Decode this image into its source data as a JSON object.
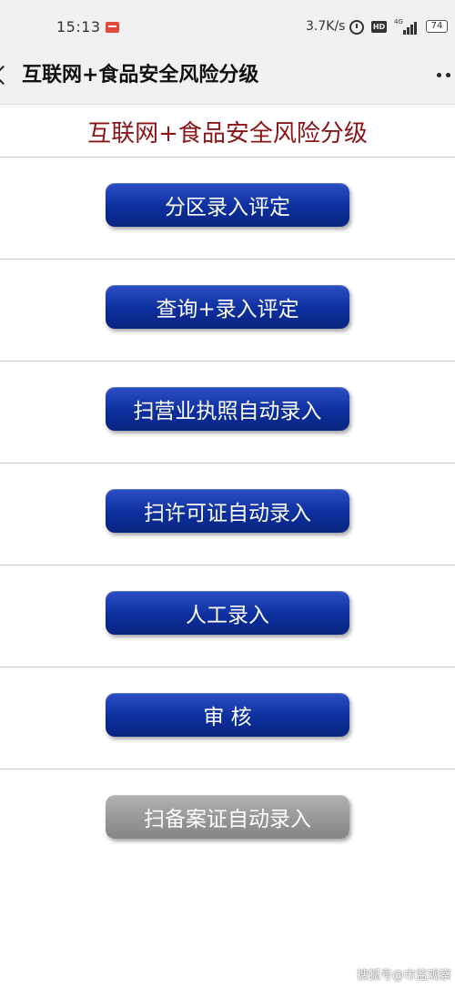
{
  "status_bar": {
    "time": "15:13",
    "net_speed": "3.7K/s",
    "hd_label": "HD",
    "signal_label": "4G",
    "battery": "74",
    "icons": [
      "notification-icon",
      "alarm-icon",
      "signal-icon",
      "battery-icon"
    ]
  },
  "header": {
    "title": "互联网+食品安全风险分级",
    "icons": [
      "back-icon",
      "more-icon"
    ]
  },
  "page": {
    "title": "互联网+食品安全风险分级"
  },
  "menu": {
    "items": [
      {
        "label": "分区录入评定",
        "state": "enabled"
      },
      {
        "label": "查询+录入评定",
        "state": "enabled"
      },
      {
        "label": "扫营业执照自动录入",
        "state": "enabled"
      },
      {
        "label": "扫许可证自动录入",
        "state": "enabled"
      },
      {
        "label": "人工录入",
        "state": "enabled"
      },
      {
        "label": "审 核",
        "state": "enabled"
      },
      {
        "label": "扫备案证自动录入",
        "state": "disabled"
      }
    ]
  },
  "watermark": "搜狐号@市监观察",
  "colors": {
    "button_blue": "#0d2f9e",
    "button_disabled": "#979797",
    "page_title": "#8a1416",
    "header_bg": "#f1f1f1"
  }
}
